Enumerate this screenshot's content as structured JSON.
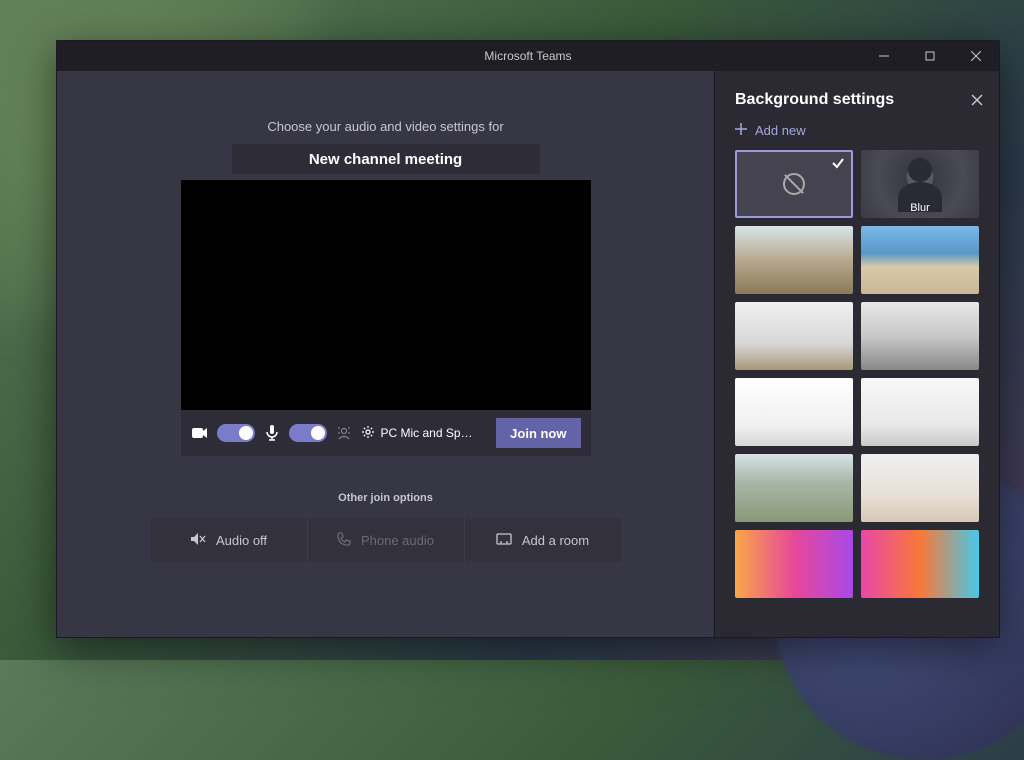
{
  "window": {
    "title": "Microsoft Teams"
  },
  "main": {
    "prompt": "Choose your audio and video settings for",
    "meeting_title": "New channel meeting",
    "device_label": "PC Mic and Sp…",
    "join_label": "Join now",
    "other_label": "Other join options",
    "options": {
      "audio_off": "Audio off",
      "phone_audio": "Phone audio",
      "add_room": "Add a room"
    }
  },
  "sidebar": {
    "title": "Background settings",
    "add_new": "Add new",
    "blur_label": "Blur"
  },
  "icons": {
    "camera": "camera-icon",
    "mic": "mic-icon",
    "blur": "bg-effects-icon",
    "gear": "gear-icon",
    "speaker_off": "speaker-off-icon",
    "phone": "phone-icon",
    "room": "room-icon",
    "plus": "plus-icon",
    "close": "close-icon",
    "check": "check-icon",
    "none": "none-icon"
  }
}
